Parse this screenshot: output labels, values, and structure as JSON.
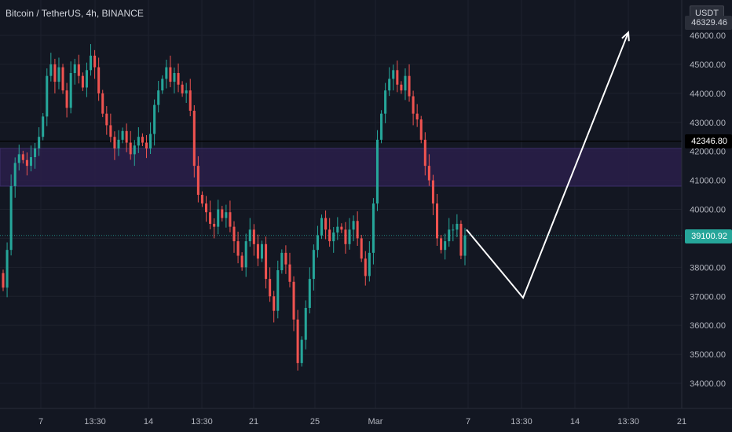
{
  "header": {
    "symbol_title": "Bitcoin / TetherUS, 4h, BINANCE",
    "currency_button": "USDT",
    "top_price_partial": "46329.46"
  },
  "price_tags": {
    "current_price": "39100.92",
    "horizontal_line_price": "42346.80",
    "current_color": "#26a69a",
    "line_color": "#000000"
  },
  "chart_data": {
    "type": "candlestick",
    "title": "Bitcoin / TetherUS, 4h, BINANCE",
    "ylim": [
      33500,
      47000
    ],
    "y_ticks": [
      34000,
      35000,
      36000,
      37000,
      38000,
      39000,
      40000,
      41000,
      42000,
      43000,
      44000,
      45000,
      46000
    ],
    "y_tick_labels": [
      "34000.00",
      "35000.00",
      "36000.00",
      "37000.00",
      "38000.00",
      "39000.00",
      "40000.00",
      "41000.00",
      "42000.00",
      "43000.00",
      "44000.00",
      "45000.00",
      "46000.00"
    ],
    "x_tick_labels": [
      "7",
      "13:30",
      "14",
      "13:30",
      "21",
      "25",
      "Mar",
      "7",
      "13:30",
      "14",
      "13:30",
      "21"
    ],
    "zone": {
      "low": 40800,
      "high": 42100,
      "color": "#2a1f4a"
    },
    "horizontal_line": 42346.8,
    "current_price": 39100.92,
    "projection": [
      [
        39300,
        "start"
      ],
      [
        36950,
        "low"
      ],
      [
        46100,
        "target"
      ]
    ],
    "up_color": "#26a69a",
    "down_color": "#ef5350",
    "closes": [
      37300,
      38600,
      40800,
      41600,
      41900,
      41700,
      41500,
      41800,
      42100,
      42500,
      43200,
      44600,
      45000,
      44400,
      44900,
      44100,
      43500,
      44700,
      45000,
      44600,
      44200,
      44800,
      45300,
      44900,
      44000,
      43300,
      42900,
      42500,
      42100,
      42400,
      42700,
      42300,
      41900,
      42200,
      42500,
      42300,
      42100,
      42600,
      43600,
      44100,
      44500,
      44900,
      44400,
      44700,
      44300,
      44000,
      44100,
      43400,
      41500,
      40500,
      40200,
      39900,
      39500,
      39400,
      40000,
      39700,
      39900,
      39400,
      38900,
      38400,
      38000,
      38900,
      39300,
      38800,
      38300,
      38800,
      37600,
      37000,
      36500,
      37900,
      38500,
      38100,
      37500,
      36200,
      34700,
      35500,
      36600,
      37600,
      38600,
      39100,
      39700,
      39300,
      38900,
      39200,
      39400,
      39300,
      38800,
      39300,
      39600,
      39000,
      38300,
      37700,
      38500,
      40200,
      42400,
      43300,
      44100,
      44500,
      44800,
      44300,
      44100,
      44600,
      43900,
      43300,
      43100,
      42400,
      41500,
      41000,
      40200,
      39000,
      38600,
      38900,
      39300,
      39300,
      39500,
      38400,
      39100
    ]
  }
}
